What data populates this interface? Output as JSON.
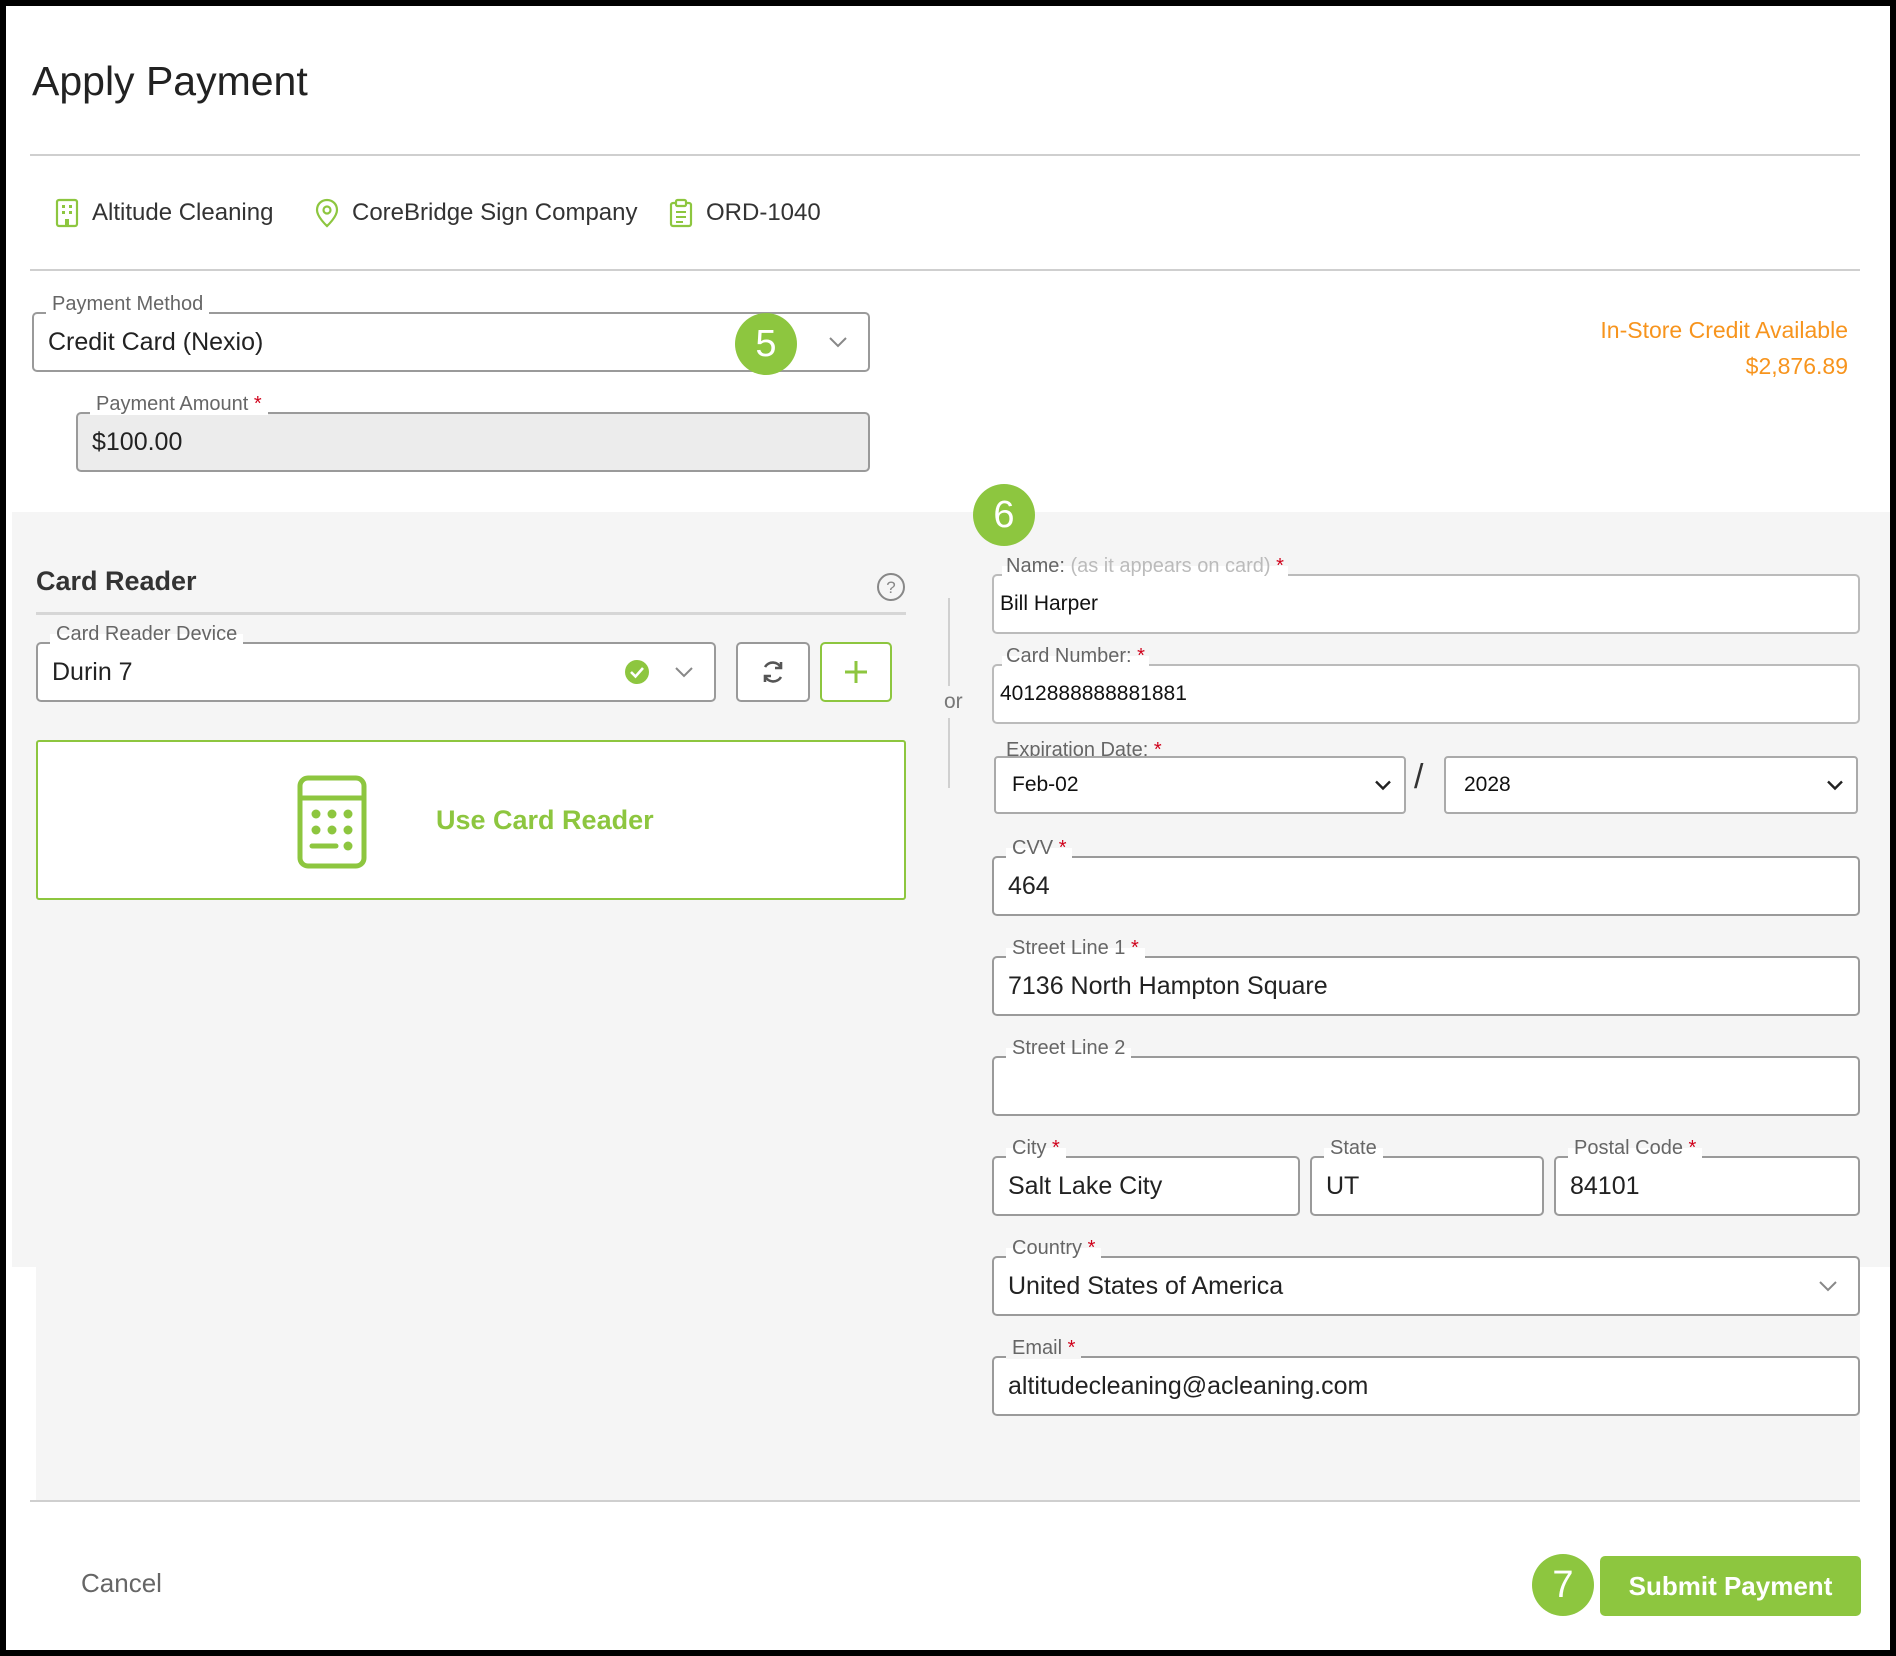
{
  "header": {
    "title": "Apply Payment"
  },
  "context": {
    "company": "Altitude Cleaning",
    "location": "CoreBridge Sign Company",
    "order": "ORD-1040"
  },
  "payment_method": {
    "label": "Payment Method",
    "value": "Credit Card (Nexio)"
  },
  "payment_amount": {
    "label": "Payment Amount",
    "value": "$100.00"
  },
  "credit": {
    "label": "In-Store Credit Available",
    "amount": "$2,876.89"
  },
  "steps": {
    "five": "5",
    "six": "6",
    "seven": "7"
  },
  "card_reader": {
    "title": "Card Reader",
    "device_label": "Card Reader Device",
    "device_value": "Durin 7",
    "use_label": "Use Card Reader"
  },
  "divider": {
    "or": "or"
  },
  "card_form": {
    "name": {
      "label": "Name:",
      "hint": "(as it appears on card)",
      "value": "Bill Harper"
    },
    "card_number": {
      "label": "Card Number:",
      "value": "4012888888881881"
    },
    "expiration": {
      "label": "Expiration Date:",
      "month": "Feb-02",
      "separator": "/",
      "year": "2028"
    },
    "cvv": {
      "label": "CVV",
      "value": "464"
    },
    "street1": {
      "label": "Street Line 1",
      "value": "7136 North Hampton Square"
    },
    "street2": {
      "label": "Street Line 2",
      "value": ""
    },
    "city": {
      "label": "City",
      "value": "Salt Lake City"
    },
    "state": {
      "label": "State",
      "value": "UT"
    },
    "postal": {
      "label": "Postal Code",
      "value": "84101"
    },
    "country": {
      "label": "Country",
      "value": "United States of America"
    },
    "email": {
      "label": "Email",
      "value": "altitudecleaning@acleaning.com"
    }
  },
  "required_marker": "*",
  "footer": {
    "cancel": "Cancel",
    "submit": "Submit Payment"
  },
  "colors": {
    "accent": "#8dc63f",
    "credit": "#f7941d",
    "required": "#d0021b"
  },
  "icons": [
    "building-icon",
    "location-pin-icon",
    "clipboard-icon",
    "chevron-down-icon",
    "help-icon",
    "check-circle-icon",
    "refresh-icon",
    "plus-icon",
    "calculator-icon"
  ]
}
